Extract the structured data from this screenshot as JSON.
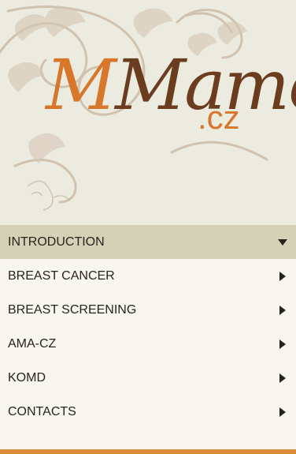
{
  "header": {
    "logo": {
      "script": "Mamo",
      "tld": ".cz"
    }
  },
  "menu": {
    "items": [
      {
        "label": "INTRODUCTION",
        "state": "expanded"
      },
      {
        "label": "BREAST CANCER",
        "state": "collapsed"
      },
      {
        "label": "BREAST SCREENING",
        "state": "collapsed"
      },
      {
        "label": "AMA-CZ",
        "state": "collapsed"
      },
      {
        "label": "KOMD",
        "state": "collapsed"
      },
      {
        "label": "CONTACTS",
        "state": "collapsed"
      }
    ]
  },
  "colors": {
    "background": "#ecebdf",
    "menu_background": "#f8f7ef",
    "active_item": "#d5d1b6",
    "text": "#2b211d",
    "accent": "#d98b37",
    "logo_orange": "#d7772b",
    "logo_brown": "#6b3d1e"
  },
  "icons": {
    "expanded": "triangle-down-icon",
    "collapsed": "triangle-right-icon"
  }
}
